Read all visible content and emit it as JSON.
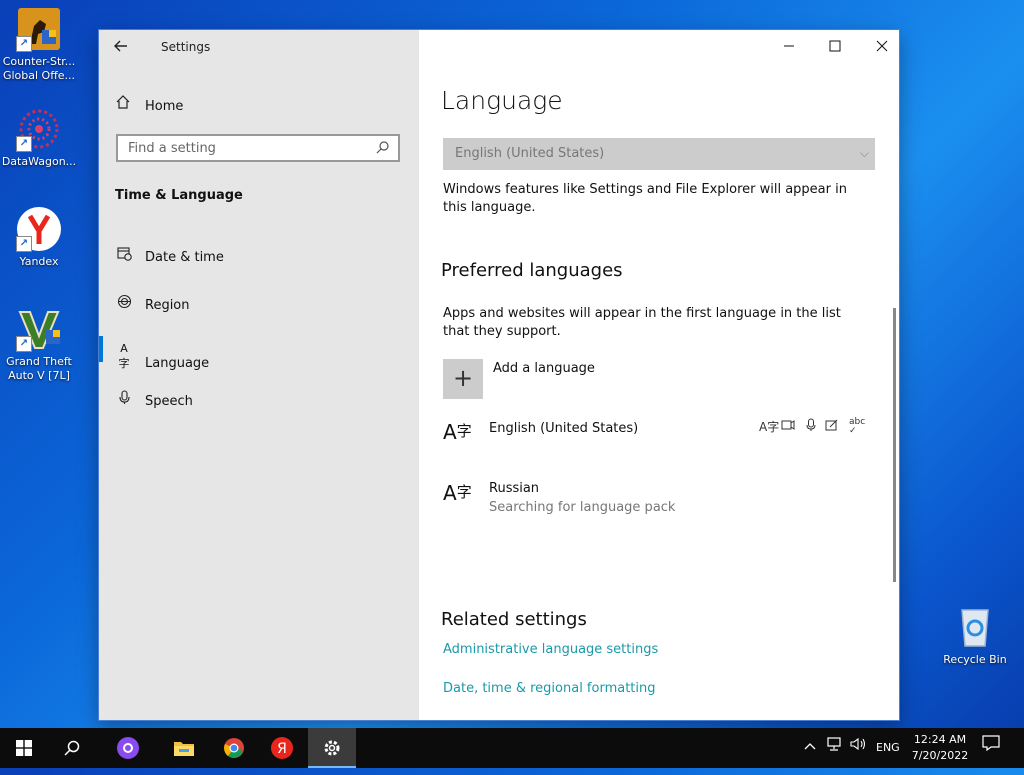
{
  "desktop": {
    "icons": [
      {
        "label": "Counter-Str... Global Offe..."
      },
      {
        "label": "DataWagon..."
      },
      {
        "label": "Yandex"
      },
      {
        "label": "Grand Theft Auto V [7L]"
      },
      {
        "label": "Recycle Bin"
      }
    ]
  },
  "window": {
    "title": "Settings",
    "nav": {
      "home": "Home",
      "search_placeholder": "Find a setting",
      "section": "Time & Language",
      "items": [
        {
          "label": "Date & time",
          "icon": "calendar-clock-icon"
        },
        {
          "label": "Region",
          "icon": "globe-icon"
        },
        {
          "label": "Language",
          "icon": "language-icon",
          "selected": true
        },
        {
          "label": "Speech",
          "icon": "microphone-icon"
        }
      ]
    },
    "main": {
      "title": "Language",
      "display_language": {
        "value": "English (United States)",
        "description": "Windows features like Settings and File Explorer will appear in this language."
      },
      "preferred": {
        "heading": "Preferred languages",
        "description": "Apps and websites will appear in the first language in the list that they support.",
        "add_label": "Add a language",
        "languages": [
          {
            "name": "English (United States)",
            "status": ""
          },
          {
            "name": "Russian",
            "status": "Searching for language pack"
          }
        ]
      },
      "related": {
        "heading": "Related settings",
        "links": [
          "Administrative language settings",
          "Date, time & regional formatting"
        ]
      }
    }
  },
  "taskbar": {
    "language": "ENG",
    "time": "12:24 AM",
    "date": "7/20/2022"
  },
  "colors": {
    "accent": "#0078d7",
    "link": "#1a9aa8",
    "nav_bg": "#e6e6e6"
  }
}
